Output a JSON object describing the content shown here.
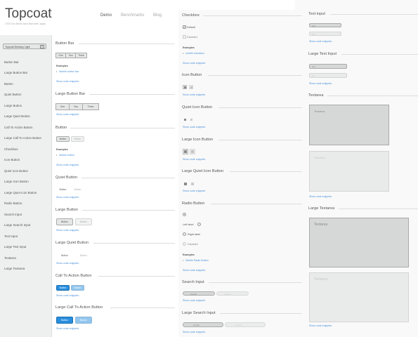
{
  "brand": {
    "title": "Topcoat",
    "subtitle": "CSS for clean and fast web apps"
  },
  "nav": {
    "demo": "Demo",
    "benchmarks": "Benchmarks",
    "blog": "Blog"
  },
  "theme_select": {
    "value": "Topcoat Desktop Light"
  },
  "sidebar": [
    "Button Bar",
    "Large Button Bar",
    "Button",
    "Quiet Button",
    "Large Button",
    "Large Quiet Button",
    "Call To Action Button",
    "Large Call To Action Button",
    "Checkbox",
    "Icon Button",
    "Quiet Icon Button",
    "Large Icon Button",
    "Large Quiet Icon Button",
    "Radio Button",
    "Search Input",
    "Large Search Input",
    "Text Input",
    "Large Text Input",
    "Textarea",
    "Large Textarea"
  ],
  "common": {
    "examples": "Examples",
    "show_code": "Show code snippets"
  },
  "c1": {
    "bb": {
      "title": "Button Bar",
      "items": [
        "One",
        "Two",
        "Three"
      ],
      "example": "Mobile button bar"
    },
    "lbb": {
      "title": "Large Button Bar",
      "items": [
        "One",
        "Two",
        "Three"
      ]
    },
    "btn": {
      "title": "Button",
      "label": "Button",
      "disabled": "Button",
      "example": "Mobile button"
    },
    "qbtn": {
      "title": "Quiet Button",
      "label": "Button",
      "disabled": "Button"
    },
    "lbtn": {
      "title": "Large Button",
      "label": "Button",
      "disabled": "Button"
    },
    "lqbtn": {
      "title": "Large Quiet Button",
      "label": "Button",
      "disabled": "Button"
    },
    "cta": {
      "title": "Call To Action Button",
      "label": "Button",
      "disabled": "Button"
    },
    "lcta": {
      "title": "Large Call To Action Button",
      "label": "Button",
      "disabled": "Button"
    }
  },
  "c2": {
    "checkbox": {
      "title": "Checkbox",
      "default": "Default",
      "disabled": "Disabled",
      "example": "mobile checkbox"
    },
    "icon": {
      "title": "Icon Button"
    },
    "qicon": {
      "title": "Quiet Icon Button"
    },
    "licon": {
      "title": "Large Icon Button"
    },
    "lqicon": {
      "title": "Large Quiet Icon Button"
    },
    "radio": {
      "title": "Radio Button",
      "left": "Left label",
      "right": "Right label",
      "disabled": "Disabled",
      "example": "Mobile Radio Button"
    },
    "search": {
      "title": "Search Input",
      "placeholder": "search"
    },
    "lsearch": {
      "title": "Large Search Input",
      "placeholder": "search"
    }
  },
  "c3": {
    "text": {
      "title": "Text input",
      "placeholder": "text"
    },
    "ltext": {
      "title": "Large Text Input",
      "placeholder": "text"
    },
    "textarea": {
      "title": "Textarea",
      "placeholder": "Textarea"
    },
    "ltextarea": {
      "title": "Large Textarea",
      "placeholder": "Textarea"
    }
  }
}
